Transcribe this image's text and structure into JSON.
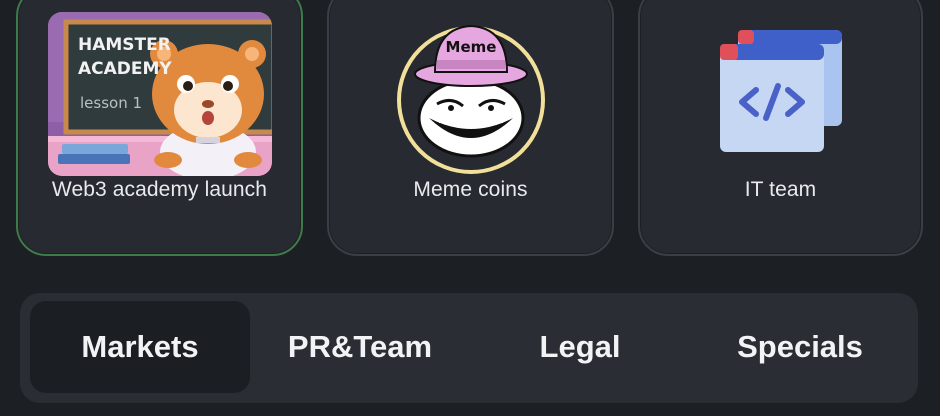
{
  "cards": [
    {
      "label": "Web3 academy launch",
      "board_text": [
        "HAMSTER",
        "ACADEMY"
      ],
      "board_subtext": "lesson 1",
      "icon": "hamster-academy-image"
    },
    {
      "label": "Meme coins",
      "hat_text": "Meme",
      "icon": "trollface-meme-image"
    },
    {
      "label": "IT team",
      "icon": "code-window-icon"
    }
  ],
  "tabs": [
    {
      "label": "Markets",
      "active": true
    },
    {
      "label": "PR&Team",
      "active": false
    },
    {
      "label": "Legal",
      "active": false
    },
    {
      "label": "Specials",
      "active": false
    }
  ],
  "colors": {
    "background": "#1c1f24",
    "card": "#272a30",
    "card_highlight_border": "#3f7a49",
    "tabbar": "#2a2d33",
    "active_tab": "#1b1e22",
    "text": "#e8eaed"
  }
}
